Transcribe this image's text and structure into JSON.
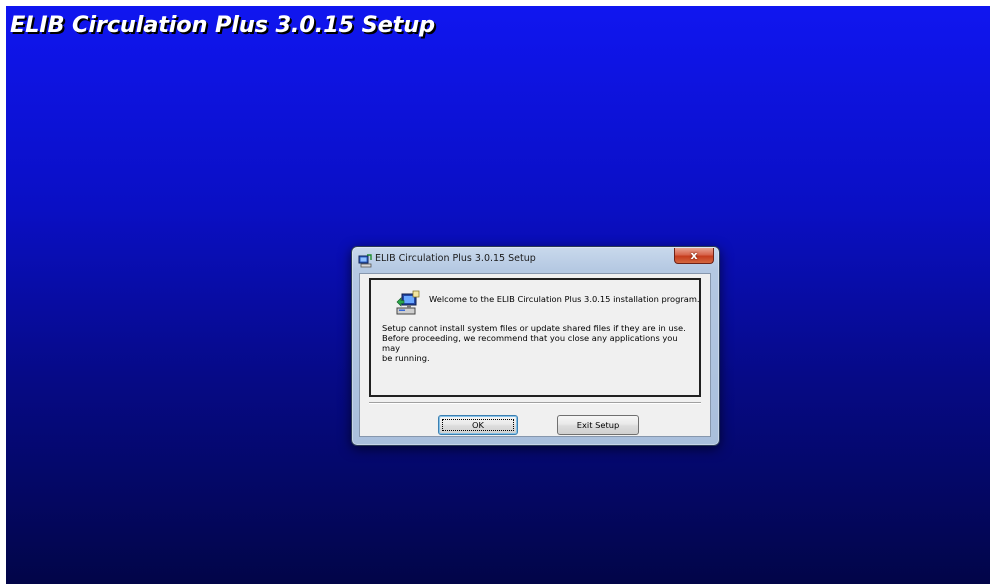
{
  "banner": {
    "title": "ELIB Circulation Plus 3.0.15 Setup"
  },
  "dialog": {
    "title": "ELIB Circulation Plus 3.0.15 Setup",
    "close_label": "x",
    "welcome": "Welcome to the ELIB Circulation Plus 3.0.15 installation program.",
    "warning_line1": "Setup cannot install system files or update shared files if they are in use.",
    "warning_line2": "Before proceeding, we recommend that you close any applications you may",
    "warning_line3": "be running.",
    "ok_label": "OK",
    "exit_label": "Exit Setup"
  },
  "colors": {
    "background_top": "#1016f0",
    "background_bottom": "#020548",
    "banner_text": "#ffffff",
    "dialog_frame": "#b4c8e2",
    "close_button": "#c53c1e",
    "client_area": "#f0f0f0"
  },
  "icons": {
    "title_icon": "setup-app-icon",
    "welcome_icon": "computer-setup-icon",
    "close_icon": "close-icon"
  }
}
